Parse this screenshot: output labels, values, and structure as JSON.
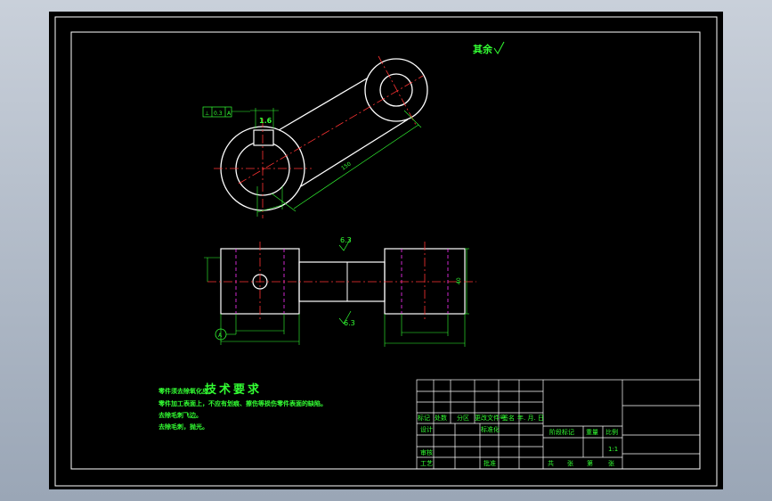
{
  "header_roughness": "其余",
  "title_block": {
    "row_labels": [
      "标记",
      "处数",
      "分区",
      "更改文件号",
      "签名",
      "年. 月. 日"
    ],
    "design": "设计",
    "standardize": "标准化",
    "review": "审核",
    "process": "工艺",
    "approve": "批准",
    "stage_mark": "阶段标记",
    "weight": "重量",
    "scale": "比例",
    "scale_value": "1:1",
    "sheet_labels": [
      "共",
      "张",
      "第",
      "张"
    ]
  },
  "tech_requirements": {
    "title": "技术要求",
    "notes": [
      "零件须去除氧化皮。",
      "零件加工表面上，不应有划痕、擦伤等损伤零件表面的缺陷。",
      "去除毛刺飞边。",
      "去除毛刺，抛光。"
    ]
  },
  "dimensions": {
    "roughness_top": "6.3",
    "roughness_bottom": "6.3",
    "roughness_upper": "1.6",
    "tolerance_frame": [
      "⊥",
      "0.3",
      "A"
    ],
    "datum": "A",
    "center_distance": "150",
    "thickness": "40"
  }
}
